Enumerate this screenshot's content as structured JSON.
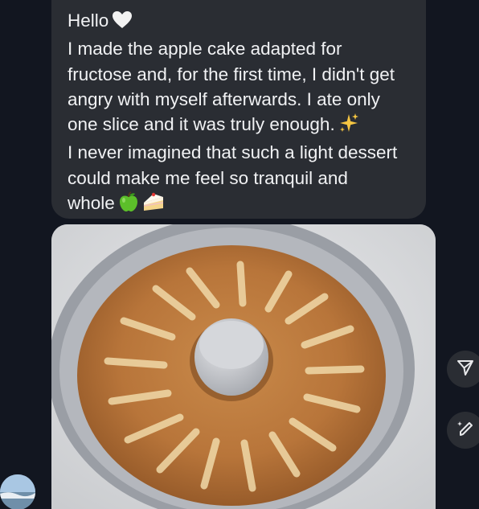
{
  "message": {
    "lines": [
      "Hello",
      "I made the apple cake adapted for",
      "fructose and, for the first time, I didn't get",
      "angry with myself afterwards. I ate only",
      "one slice and it was truly enough.",
      "I never imagined that such a light dessert",
      "could make me feel so tranquil and",
      "whole"
    ],
    "emojis": {
      "line1": "white-heart-icon",
      "line5": "sparkles-icon",
      "line8": [
        "green-apple-icon",
        "cake-slice-icon"
      ]
    }
  },
  "attachment": {
    "type": "photo",
    "subject": "apple-cake-photo"
  },
  "actions": {
    "share_icon": "share-icon",
    "edit_icon": "edit-ai-icon"
  },
  "colors": {
    "background": "#121620",
    "bubble": "#2a2d33",
    "text": "#f1f2f4"
  }
}
